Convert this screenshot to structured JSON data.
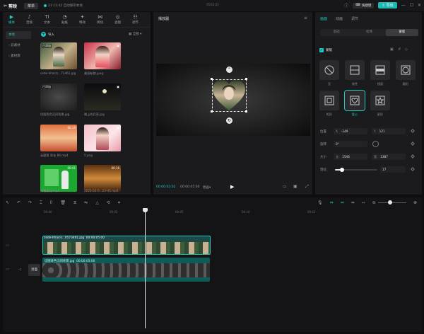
{
  "titlebar": {
    "app_name": "剪映",
    "menu_label": "菜单",
    "autosave": "21:11:42 自动保存本地",
    "project_name": "0502(2)",
    "shortcut_label": "快捷键",
    "export_label": "导出"
  },
  "media": {
    "tools": [
      {
        "label": "媒体",
        "icon": "▶"
      },
      {
        "label": "音频",
        "icon": "♪"
      },
      {
        "label": "文本",
        "icon": "TI"
      },
      {
        "label": "贴纸",
        "icon": "◔"
      },
      {
        "label": "特效",
        "icon": "✦"
      },
      {
        "label": "转场",
        "icon": "⋈"
      },
      {
        "label": "滤镜",
        "icon": "◎"
      },
      {
        "label": "调节",
        "icon": "☷"
      }
    ],
    "side": [
      "本地",
      "› 云素材",
      "› 素材库"
    ],
    "import_label": "导入",
    "sort_label": "全部",
    "thumbs": [
      {
        "label": "cede-hhacis...73461.jpg",
        "badge": "已添加",
        "dur": ""
      },
      {
        "label": "美丽新娘.jpeg",
        "badge": "",
        "dur": ""
      },
      {
        "label": "切图背色沉闷背景.jpg",
        "badge": "已添加",
        "dur": ""
      },
      {
        "label": "晚上的月亮.jpg",
        "badge": "",
        "dur": ""
      },
      {
        "label": "无题第 背化 88.mp4",
        "badge": "",
        "dur": "00:10"
      },
      {
        "label": "5.png",
        "badge": "",
        "dur": ""
      },
      {
        "label": "绿幕素材.mp4",
        "badge": "",
        "dur": "00:41"
      },
      {
        "label": "2022-02-0...23-45.mp4",
        "badge": "",
        "dur": "00:16"
      }
    ]
  },
  "player": {
    "title": "播放器",
    "current": "00:00:03:02",
    "total": "00:00:05:00",
    "quality": "原画"
  },
  "props": {
    "tabs": [
      "画面",
      "动画",
      "调节"
    ],
    "subtabs": [
      "基础",
      "抠像",
      "蒙版"
    ],
    "mask_title": "蒙版",
    "masks": [
      "无",
      "线性",
      "镜面",
      "圆形",
      "矩形",
      "爱心",
      "星形"
    ],
    "position_label": "位置",
    "pos_x": "-149",
    "pos_y": "121",
    "x_key": "X",
    "y_key": "Y",
    "rotate_label": "旋转",
    "rotate_value": "0°",
    "size_label": "大小",
    "width_key": "长",
    "width_value": "1546",
    "height_key": "宽",
    "height_value": "1387",
    "feather_label": "羽化",
    "feather_value": "17"
  },
  "feather_level": 0.17,
  "timeline": {
    "ticks": [
      "00:00",
      "00:02",
      "00:05",
      "00:10",
      "00:15"
    ],
    "clip1_name": "cede-hhacis...0573461.jpg",
    "clip1_dur": "00:00:05:00",
    "clip2_name": "切图背色沉闷背景.jpg",
    "clip2_dur": "00:00:05:00",
    "cover_label": "封面"
  },
  "colors": {
    "accent": "#22c7c0",
    "panel": "#1b1b1e",
    "background": "#0e0e10"
  }
}
